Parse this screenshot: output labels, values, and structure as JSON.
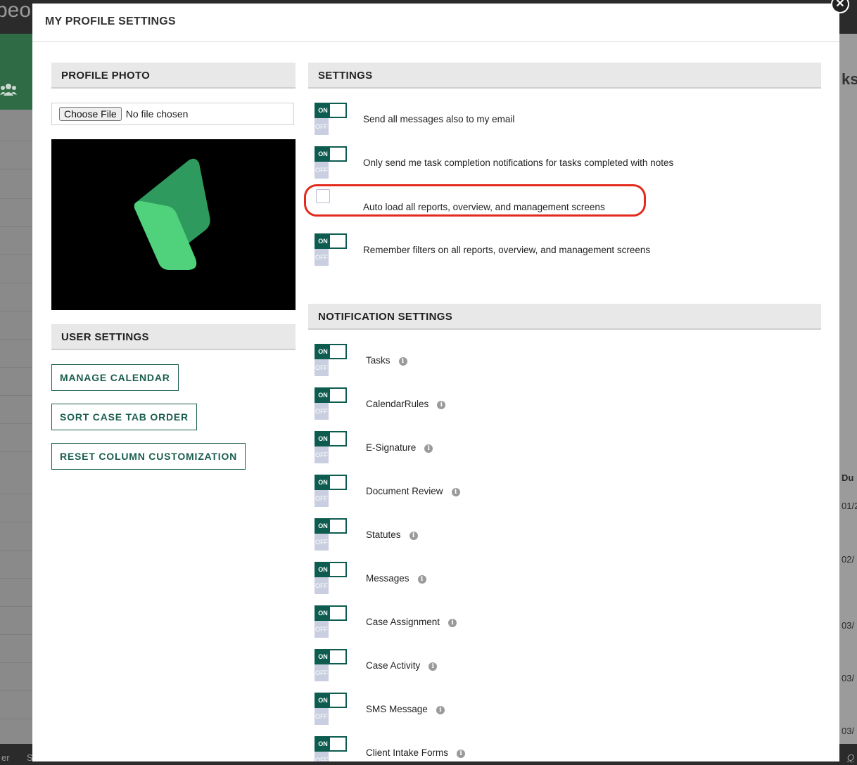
{
  "background": {
    "brand_fragment": "peo",
    "right_heading_fragment": "ks",
    "right_column_header": "Du",
    "right_dates": [
      "01/2",
      "02/",
      "03/",
      "03/",
      "03/"
    ],
    "bottom_fragments": [
      "er",
      "S",
      "Q"
    ]
  },
  "modal": {
    "title": "MY PROFILE SETTINGS",
    "close_glyph": "✕"
  },
  "profile_photo": {
    "heading": "PROFILE PHOTO",
    "file_button": "Choose File",
    "file_status": "No file chosen"
  },
  "user_settings": {
    "heading": "USER SETTINGS",
    "buttons": [
      "MANAGE CALENDAR",
      "SORT CASE TAB ORDER",
      "RESET COLUMN CUSTOMIZATION"
    ]
  },
  "toggle_text": {
    "on": "ON",
    "off": "OFF"
  },
  "settings": {
    "heading": "SETTINGS",
    "items": [
      {
        "label": "Send all messages also to my email",
        "control": "toggle",
        "state": "on"
      },
      {
        "label": "Only send me task completion notifications for tasks completed with notes",
        "control": "toggle",
        "state": "on"
      },
      {
        "label": "Auto load all reports, overview, and management screens",
        "control": "checkbox",
        "checked": false,
        "highlighted": true
      },
      {
        "label": "Remember filters on all reports, overview, and management screens",
        "control": "toggle",
        "state": "on"
      }
    ]
  },
  "notification_settings": {
    "heading": "NOTIFICATION SETTINGS",
    "items": [
      {
        "label": "Tasks",
        "state": "on"
      },
      {
        "label": "CalendarRules",
        "state": "on"
      },
      {
        "label": "E-Signature",
        "state": "on"
      },
      {
        "label": "Document Review",
        "state": "on"
      },
      {
        "label": "Statutes",
        "state": "on"
      },
      {
        "label": "Messages",
        "state": "on"
      },
      {
        "label": "Case Assignment",
        "state": "on"
      },
      {
        "label": "Case Activity",
        "state": "on"
      },
      {
        "label": "SMS Message",
        "state": "on"
      },
      {
        "label": "Client Intake Forms",
        "state": "on"
      }
    ]
  },
  "colors": {
    "accent": "#0e5c50",
    "off": "#c9cfe0",
    "highlight": "#e32a1d"
  }
}
